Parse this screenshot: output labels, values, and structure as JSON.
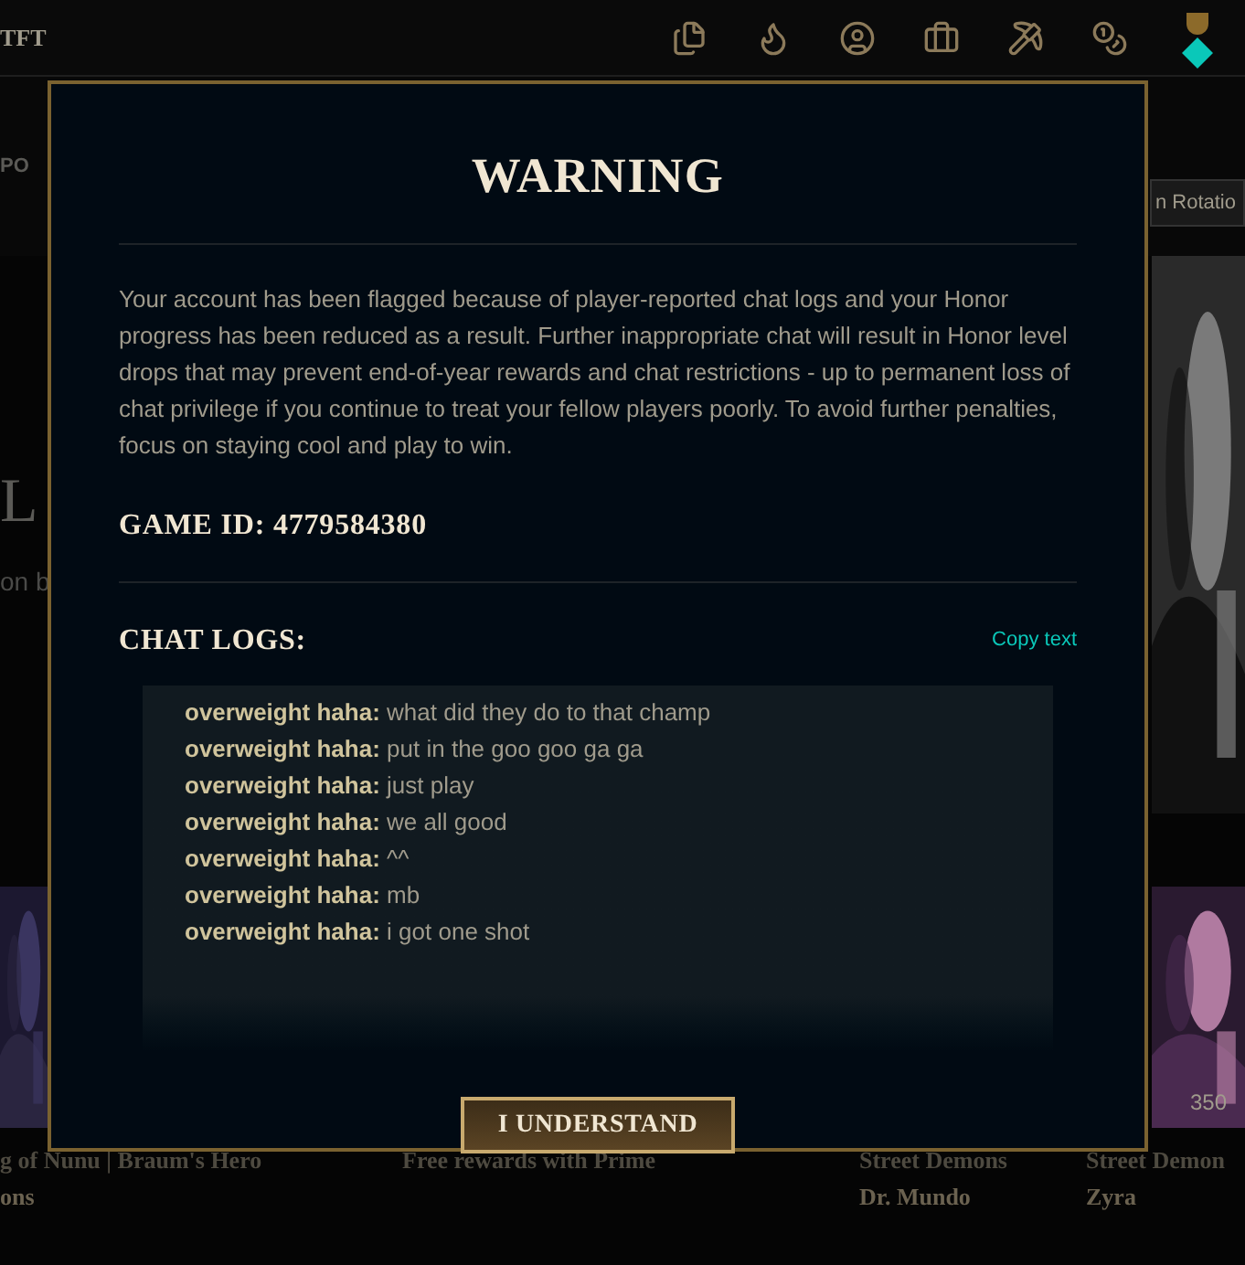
{
  "background": {
    "nav_label": "TFT",
    "tab_label": "PO",
    "rotation_button": "n Rotatio",
    "hero_title": "L",
    "hero_subtitle": "on b",
    "cards": [
      {
        "title": "g of Nunu | Braum's Hero",
        "subtitle": "ons"
      },
      {
        "title": "Free rewards with Prime"
      },
      {
        "title": "Street Demons",
        "subtitle": "Dr. Mundo"
      },
      {
        "title": "Street Demon",
        "subtitle": "Zyra",
        "price": "350"
      }
    ]
  },
  "dialog": {
    "title": "WARNING",
    "message": "Your account has been flagged because of player-reported chat logs and your Honor progress has been reduced as a result. Further inappropriate chat will result in Honor level drops that may prevent end-of-year rewards and chat restrictions - up to permanent loss of chat privilege if you continue to treat your fellow players poorly. To avoid further penalties, focus on staying cool and play to win.",
    "game_id": "GAME ID: 4779584380",
    "chat_logs_title": "CHAT LOGS:",
    "copy_link": "Copy text",
    "chat": [
      {
        "name": "overweight haha:",
        "text": "what did they do to that champ"
      },
      {
        "name": "overweight haha:",
        "text": "put in the goo goo ga ga"
      },
      {
        "name": "overweight haha:",
        "text": "just play"
      },
      {
        "name": "overweight haha:",
        "text": "we all good"
      },
      {
        "name": "overweight haha:",
        "text": "^^"
      },
      {
        "name": "overweight haha:",
        "text": "mb"
      },
      {
        "name": "overweight haha:",
        "text": "i got one shot"
      }
    ],
    "button": "I UNDERSTAND"
  }
}
